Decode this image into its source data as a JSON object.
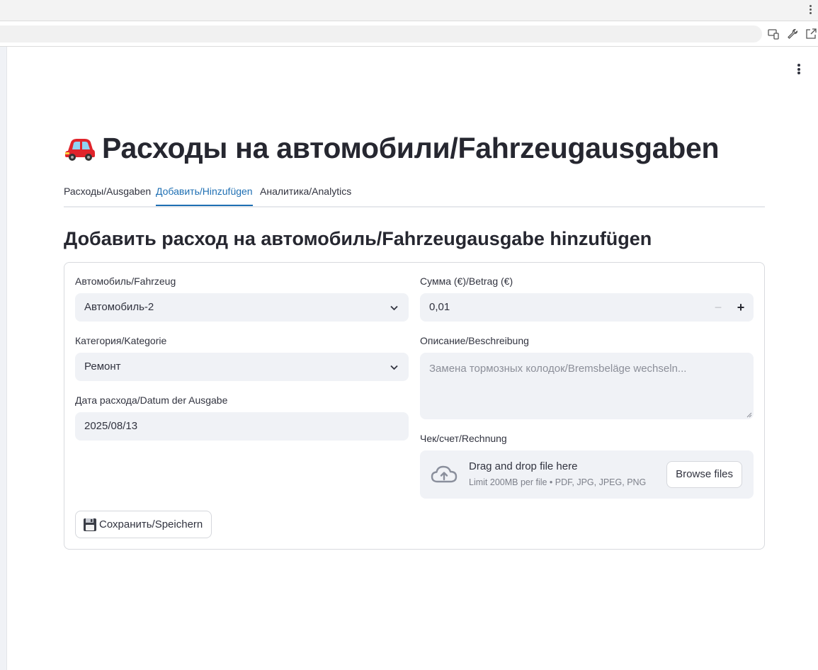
{
  "app": {
    "title": "Расходы на автомобили/Fahrzeugausgaben",
    "title_icon": "red-car-icon"
  },
  "tabs": [
    {
      "label": "Расходы/Ausgaben",
      "active": false
    },
    {
      "label": "Добавить/Hinzufügen",
      "active": true
    },
    {
      "label": "Аналитика/Analytics",
      "active": false
    }
  ],
  "section": {
    "title": "Добавить расход на автомобиль/Fahrzeugausgabe hinzufügen"
  },
  "form": {
    "vehicle": {
      "label": "Автомобиль/Fahrzeug",
      "value": "Автомобиль-2"
    },
    "category": {
      "label": "Категория/Kategorie",
      "value": "Ремонт"
    },
    "date": {
      "label": "Дата расхода/Datum der Ausgabe",
      "value": "2025/08/13"
    },
    "amount": {
      "label": "Сумма (€)/Betrag (€)",
      "value": "0,01",
      "minus": "−",
      "plus": "+"
    },
    "description": {
      "label": "Описание/Beschreibung",
      "placeholder": "Замена тормозных колодок/Bremsbeläge wechseln..."
    },
    "receipt": {
      "label": "Чек/счет/Rechnung",
      "drag_text": "Drag and drop file here",
      "limit_text": "Limit 200MB per file • PDF, JPG, JPEG, PNG",
      "browse_label": "Browse files"
    },
    "save_label": "Сохранить/Speichern"
  },
  "colors": {
    "accent": "#1e6fb3",
    "input_bg": "#f0f2f6",
    "text": "#31333f"
  }
}
